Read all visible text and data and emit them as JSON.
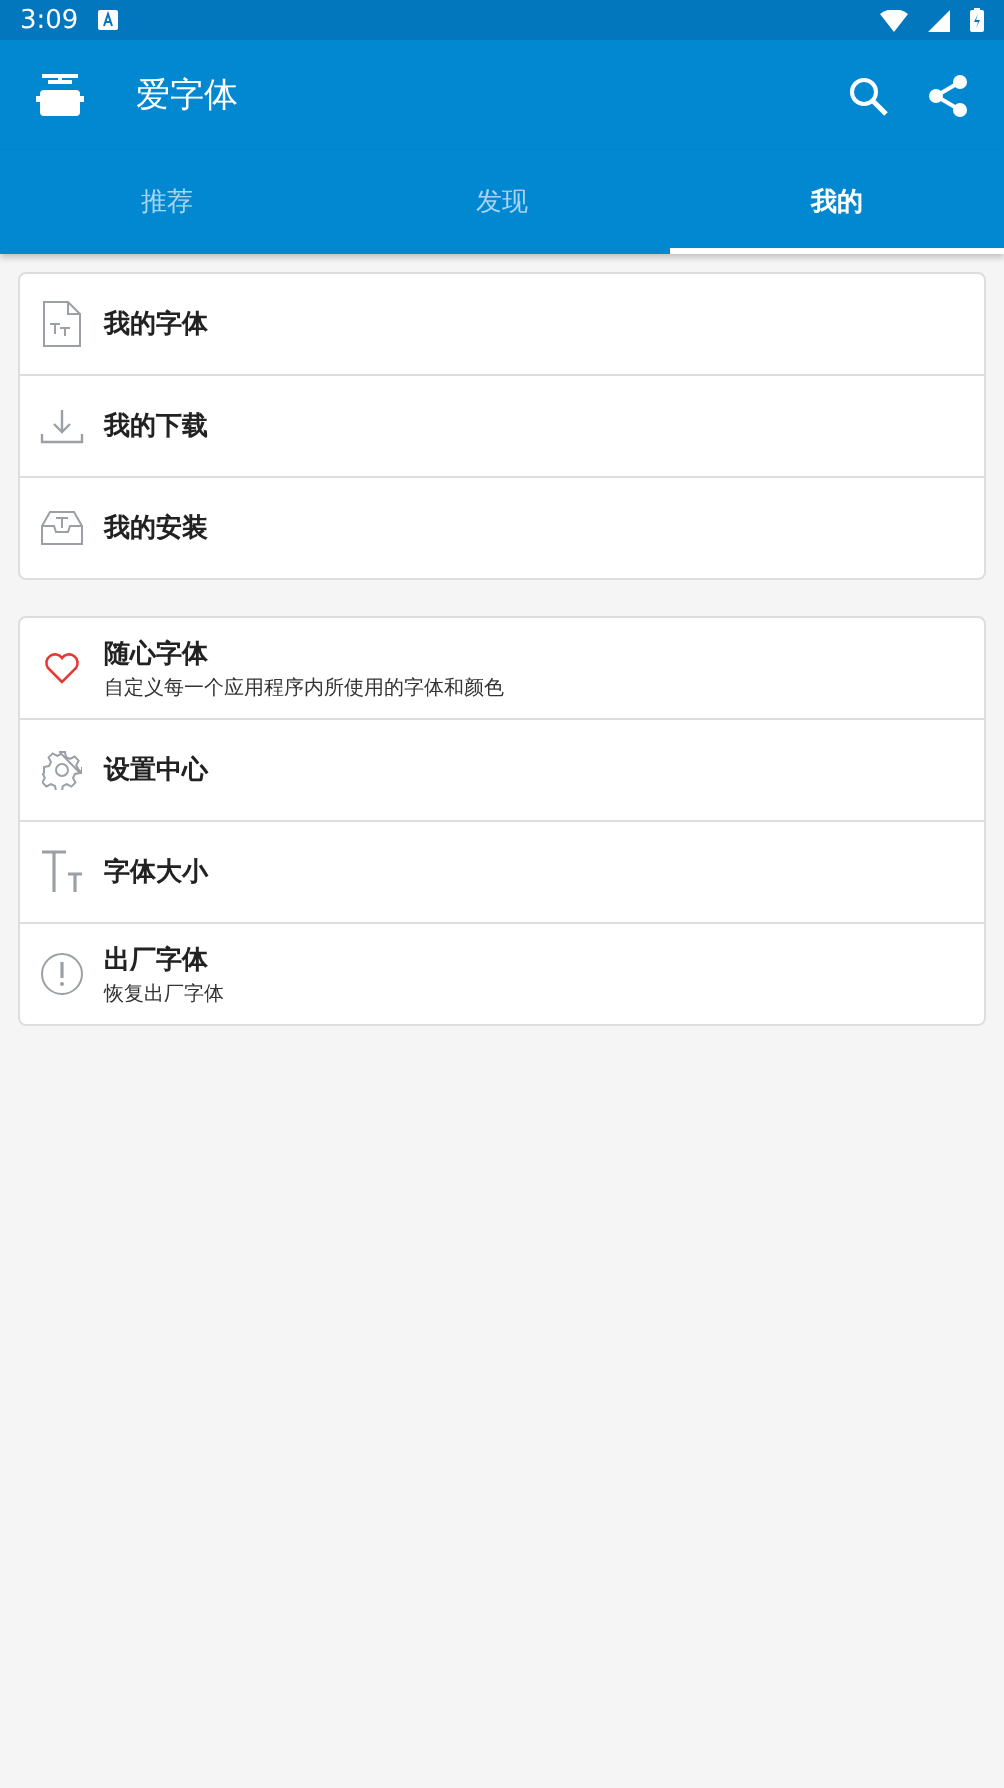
{
  "status_bar": {
    "time": "3:09"
  },
  "app_bar": {
    "title": "爱字体"
  },
  "tabs": [
    {
      "label": "推荐",
      "selected": false
    },
    {
      "label": "发现",
      "selected": false
    },
    {
      "label": "我的",
      "selected": true
    }
  ],
  "groups": [
    {
      "items": [
        {
          "title": "我的字体"
        },
        {
          "title": "我的下载"
        },
        {
          "title": "我的安装"
        }
      ]
    },
    {
      "items": [
        {
          "title": "随心字体",
          "subtitle": "自定义每一个应用程序内所使用的字体和颜色"
        },
        {
          "title": "设置中心"
        },
        {
          "title": "字体大小"
        },
        {
          "title": "出厂字体",
          "subtitle": "恢复出厂字体"
        }
      ]
    }
  ]
}
